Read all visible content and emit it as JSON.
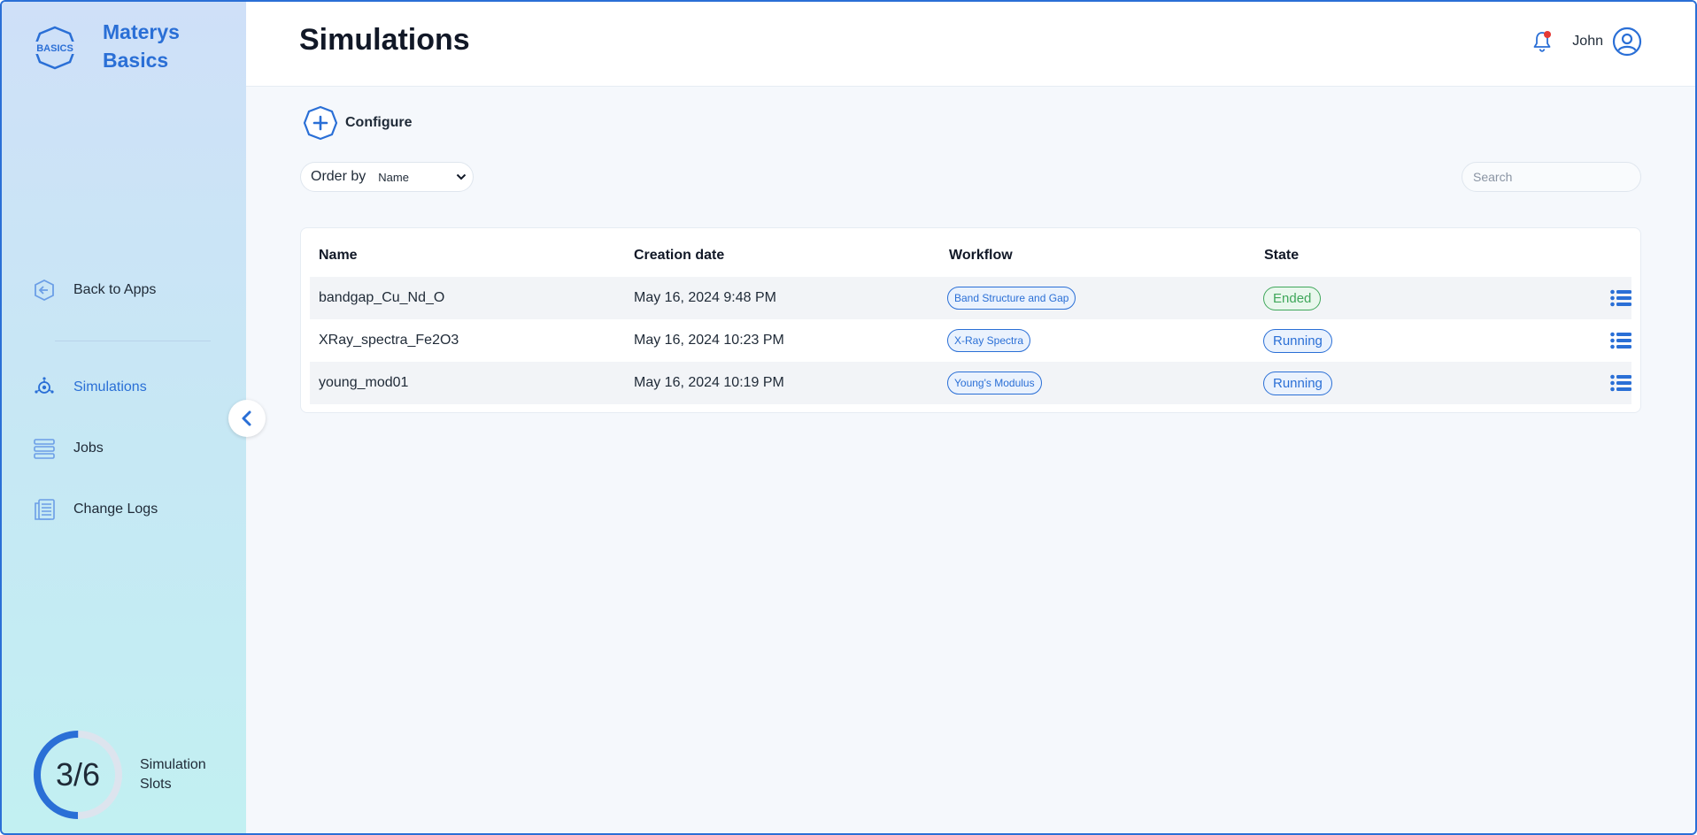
{
  "brand": {
    "logo_text": "BASICS",
    "name_line1": "Materys",
    "name_line2": "Basics"
  },
  "sidebar": {
    "items": [
      {
        "label": "Back to Apps",
        "icon": "back-arrow-icon"
      },
      {
        "label": "Simulations",
        "icon": "simulations-icon",
        "active": true
      },
      {
        "label": "Jobs",
        "icon": "jobs-icon"
      },
      {
        "label": "Change Logs",
        "icon": "change-logs-icon"
      }
    ],
    "slots": {
      "value": "3/6",
      "used": 3,
      "total": 6,
      "label": "Simulation Slots"
    }
  },
  "header": {
    "title": "Simulations",
    "user_name": "John",
    "has_notification": true
  },
  "toolbar": {
    "configure_label": "Configure",
    "order_by_label": "Order by",
    "order_by_value": "Name",
    "search_placeholder": "Search"
  },
  "table": {
    "columns": [
      "Name",
      "Creation date",
      "Workflow",
      "State"
    ],
    "rows": [
      {
        "name": "bandgap_Cu_Nd_O",
        "date": "May 16, 2024 9:48 PM",
        "workflow": "Band Structure and Gap",
        "state": "Ended"
      },
      {
        "name": "XRay_spectra_Fe2O3",
        "date": "May 16, 2024 10:23 PM",
        "workflow": "X-Ray Spectra",
        "state": "Running"
      },
      {
        "name": "young_mod01",
        "date": "May 16, 2024 10:19 PM",
        "workflow": "Young's Modulus",
        "state": "Running"
      }
    ]
  },
  "colors": {
    "accent": "#2a6fd6",
    "ended": "#3fa75a",
    "notification": "#e53935"
  }
}
